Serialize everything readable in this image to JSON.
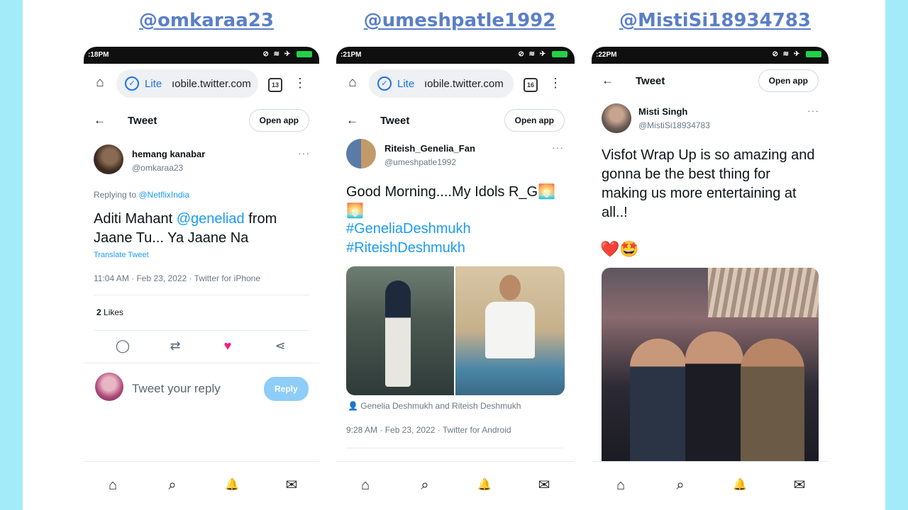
{
  "panels": [
    {
      "handle_heading": "@omkaraa23",
      "status_time": ":18PM",
      "url_lite": "Lite",
      "url_text": "ıobile.twitter.com",
      "tabs_count": "13",
      "tweet_header": {
        "title": "Tweet",
        "open_app": "Open app"
      },
      "author": {
        "name": "hemang kanabar",
        "handle": "@omkaraa23"
      },
      "replying": {
        "prefix": "Replying to ",
        "target": "@NetflixIndia"
      },
      "text": {
        "part1": "Aditi Mahant ",
        "mention": "@geneliad",
        "part2": "  from Jaane Tu... Ya Jaane Na"
      },
      "translate": "Translate Tweet",
      "meta": "11:04 AM · Feb 23, 2022 · Twitter for iPhone",
      "likes": {
        "count": "2",
        "label": " Likes"
      },
      "reply": {
        "placeholder": "Tweet your reply",
        "button": "Reply"
      }
    },
    {
      "handle_heading": "@umeshpatle1992",
      "status_time": ":21PM",
      "url_lite": "Lite",
      "url_text": "ıobile.twitter.com",
      "tabs_count": "16",
      "tweet_header": {
        "title": "Tweet",
        "open_app": "Open app"
      },
      "author": {
        "name": "Riteish_Genelia_Fan",
        "handle": "@umeshpatle1992"
      },
      "text": {
        "line1": "Good Morning....My Idols R_G🌅",
        "line2": "🌅"
      },
      "hashtags": [
        "#GeneliaDeshmukh",
        "#RiteishDeshmukh"
      ],
      "photo_tags": "Genelia Deshmukh and Riteish Deshmukh",
      "meta": "9:28 AM · Feb 23, 2022 · Twitter for Android"
    },
    {
      "handle_heading": "@MistiSi18934783",
      "status_time": ":22PM",
      "tweet_header": {
        "title": "Tweet",
        "open_app": "Open app"
      },
      "author": {
        "name": "Misti Singh",
        "handle": "@MistiSi18934783"
      },
      "text": "Visfot Wrap Up  is so amazing and gonna be the best thing for making us more entertaining at all..!",
      "emojis": "❤️🤩"
    }
  ],
  "icons": {
    "home": "⌂",
    "back": "←",
    "more": "···",
    "reply": "◯",
    "retweet": "⇄",
    "like": "♥",
    "share": "⋖",
    "search": "⌕",
    "bell": "🔔",
    "mail": "✉",
    "lite": "✓",
    "person": "👤",
    "menu": "⋮"
  },
  "colors": {
    "accent": "#1d9bf0",
    "heading": "#5b7fc6",
    "side_strip": "#a4ebf9",
    "like": "#f91880"
  }
}
